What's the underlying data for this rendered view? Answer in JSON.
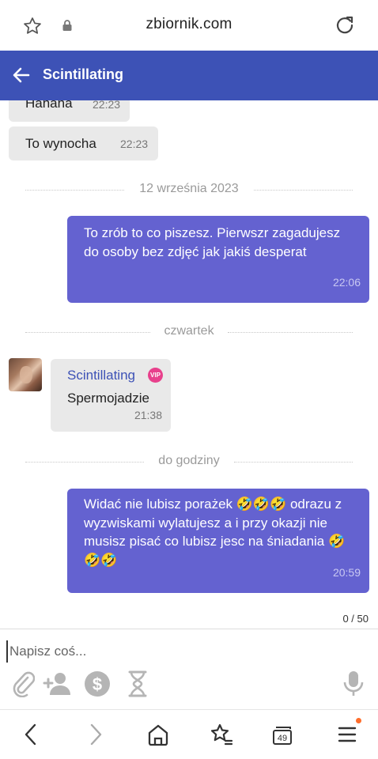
{
  "browser": {
    "domain": "zbiornik.com",
    "tabs_count": "49"
  },
  "header": {
    "title": "Scintillating"
  },
  "messages": {
    "m1": {
      "text": "Hahaha",
      "time": "22:23"
    },
    "m2": {
      "text": "To wynocha",
      "time": "22:23"
    },
    "d1": "12 września 2023",
    "m3": {
      "text": "To zrób to co piszesz. Pierwszr zagadujesz do osoby bez zdjęć jak jakiś desperat",
      "time": "22:06"
    },
    "d2": "czwartek",
    "m4": {
      "sender": "Scintillating",
      "vip": "VIP",
      "text": "Spermojadzie",
      "time": "21:38"
    },
    "d3": "do godziny",
    "m5": {
      "text": "Widać nie lubisz porażek 🤣🤣🤣 odrazu z wyzwiskami wylatujesz a i przy okazji nie musisz pisać co lubisz jesc na śniadania 🤣🤣🤣",
      "time": "20:59"
    }
  },
  "composer": {
    "placeholder": "Napisz coś...",
    "counter": "0 / 50"
  },
  "colors": {
    "header": "#3d52b6",
    "outgoing_bubble": "#6462d0",
    "incoming_bubble": "#e9e9e9",
    "vip_badge": "#e8408c",
    "sender_name": "#3d52b6"
  },
  "icons": {
    "star": "star-icon",
    "lock": "lock-icon",
    "reload": "reload-icon",
    "back": "back-arrow-icon",
    "attach": "paperclip-icon",
    "add_user": "add-user-icon",
    "money": "dollar-icon",
    "timer": "hourglass-icon",
    "mic": "microphone-icon",
    "nav_back": "chevron-left-icon",
    "nav_forward": "chevron-right-icon",
    "home": "home-icon",
    "bookmarks": "star-list-icon",
    "tabs": "tabs-icon",
    "menu": "menu-icon"
  }
}
